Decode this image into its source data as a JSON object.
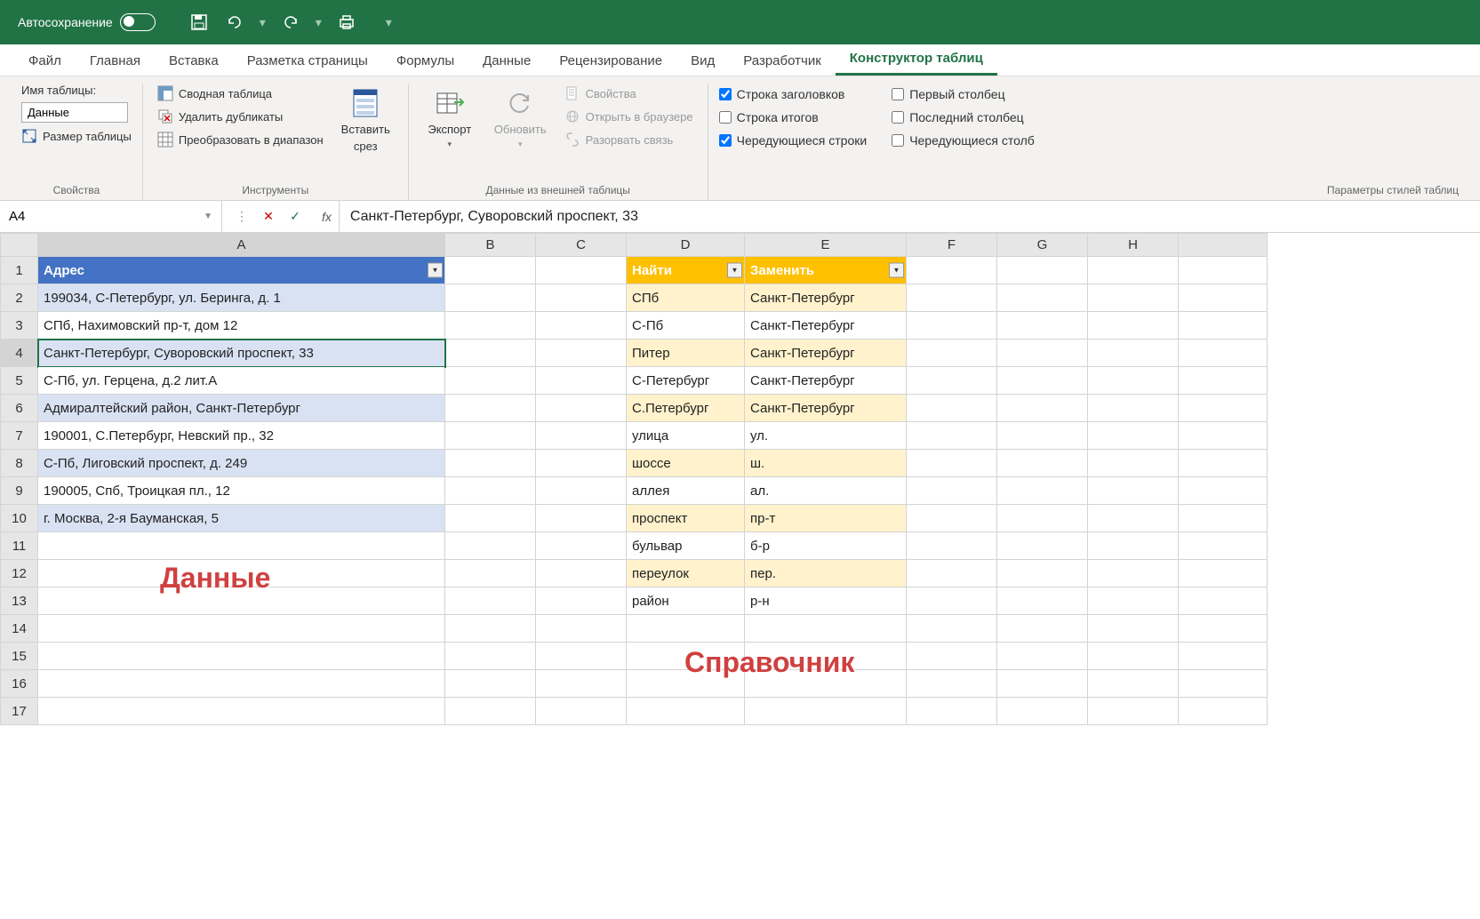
{
  "titlebar": {
    "autosave_label": "Автосохранение"
  },
  "ribbon_tabs": [
    "Файл",
    "Главная",
    "Вставка",
    "Разметка страницы",
    "Формулы",
    "Данные",
    "Рецензирование",
    "Вид",
    "Разработчик",
    "Конструктор таблиц"
  ],
  "active_tab": "Конструктор таблиц",
  "ribbon": {
    "props": {
      "name_label": "Имя таблицы:",
      "name_value": "Данные",
      "size_label": "Размер таблицы",
      "group_label": "Свойства"
    },
    "tools": {
      "pivot": "Сводная таблица",
      "dedup": "Удалить дубликаты",
      "torange": "Преобразовать в диапазон",
      "slicer_t1": "Вставить",
      "slicer_t2": "срез",
      "group_label": "Инструменты"
    },
    "external": {
      "export": "Экспорт",
      "refresh": "Обновить",
      "props": "Свойства",
      "browser": "Открыть в браузере",
      "unlink": "Разорвать связь",
      "group_label": "Данные из внешней таблицы"
    },
    "styleopts": {
      "header_row": "Строка заголовков",
      "total_row": "Строка итогов",
      "banded_rows": "Чередующиеся строки",
      "first_col": "Первый столбец",
      "last_col": "Последний столбец",
      "banded_cols": "Чередующиеся столб",
      "group_label": "Параметры стилей таблиц"
    }
  },
  "formula_bar": {
    "name_box": "A4",
    "fx": "fx",
    "value": "Санкт-Петербург, Суворовский проспект, 33"
  },
  "columns": [
    "A",
    "B",
    "C",
    "D",
    "E",
    "F",
    "G",
    "H"
  ],
  "active_cell": "A4",
  "table_address": {
    "header": "Адрес",
    "rows": [
      "199034, С-Петербург, ул. Беринга, д. 1",
      "СПб, Нахимовский пр-т, дом 12",
      "Санкт-Петербург, Суворовский проспект, 33",
      "С-Пб, ул. Герцена, д.2 лит.А",
      "Адмиралтейский район, Санкт-Петербург",
      "190001, С.Петербург, Невский пр., 32",
      "С-Пб, Лиговский проспект, д. 249",
      "190005, Спб, Троицкая пл., 12",
      "г. Москва, 2-я Бауманская, 5"
    ]
  },
  "table_lookup": {
    "header_find": "Найти",
    "header_replace": "Заменить",
    "rows": [
      {
        "find": "СПб",
        "replace": "Санкт-Петербург"
      },
      {
        "find": "С-Пб",
        "replace": "Санкт-Петербург"
      },
      {
        "find": "Питер",
        "replace": "Санкт-Петербург"
      },
      {
        "find": "С-Петербург",
        "replace": "Санкт-Петербург"
      },
      {
        "find": "С.Петербург",
        "replace": "Санкт-Петербург"
      },
      {
        "find": "улица",
        "replace": "ул."
      },
      {
        "find": "шоссе",
        "replace": "ш."
      },
      {
        "find": "аллея",
        "replace": "ал."
      },
      {
        "find": "проспект",
        "replace": "пр-т"
      },
      {
        "find": "бульвар",
        "replace": "б-р"
      },
      {
        "find": "переулок",
        "replace": "пер."
      },
      {
        "find": "район",
        "replace": "р-н"
      }
    ]
  },
  "annotations": {
    "data_label": "Данные",
    "lookup_label": "Справочник"
  }
}
